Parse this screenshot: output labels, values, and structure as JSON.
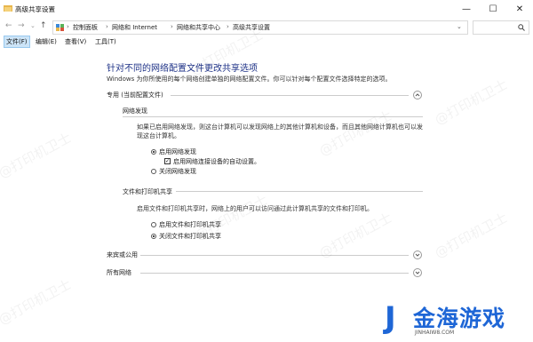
{
  "window": {
    "title": "高级共享设置",
    "minimize_glyph": "—",
    "maximize_glyph": "☐",
    "close_glyph": "✕"
  },
  "nav": {
    "back_glyph": "←",
    "forward_glyph": "→",
    "dropdown_glyph": "⌄",
    "up_glyph": "↑",
    "address_dropdown_glyph": "⌄",
    "breadcrumbs": [
      "控制面板",
      "网络和 Internet",
      "网络和共享中心",
      "高级共享设置"
    ]
  },
  "menu": {
    "items": [
      "文件(F)",
      "编辑(E)",
      "查看(V)",
      "工具(T)"
    ]
  },
  "page": {
    "title": "针对不同的网络配置文件更改共享选项",
    "description": "Windows 为你所使用的每个网络创建单独的网络配置文件。你可以针对每个配置文件选择特定的选项。"
  },
  "private": {
    "header": "专用 (当前配置文件)",
    "network_discovery": {
      "header": "网络发现",
      "text": "如果已启用网络发现，则这台计算机可以发现网络上的其他计算机和设备，而且其他网络计算机也可以发现这台计算机。",
      "options": {
        "on": "启用网络发现",
        "auto": "启用网络连接设备的自动设置。",
        "off": "关闭网络发现"
      },
      "selected": "on",
      "auto_checked": true
    },
    "file_printer_sharing": {
      "header": "文件和打印机共享",
      "text": "启用文件和打印机共享时，网络上的用户可以访问通过此计算机共享的文件和打印机。",
      "options": {
        "on": "启用文件和打印机共享",
        "off": "关闭文件和打印机共享"
      },
      "selected": "off"
    }
  },
  "guest": {
    "header": "来宾或公用"
  },
  "all": {
    "header": "所有网络"
  },
  "watermark": {
    "text": "@打印机卫士"
  },
  "brand": {
    "logo_letter": "J",
    "name": "金海游戏",
    "url": "JINHAIW8.COM"
  },
  "colors": {
    "title_blue": "#1e3287",
    "brand_blue": "#1e66d6",
    "menu_active": "#cce4f7"
  }
}
